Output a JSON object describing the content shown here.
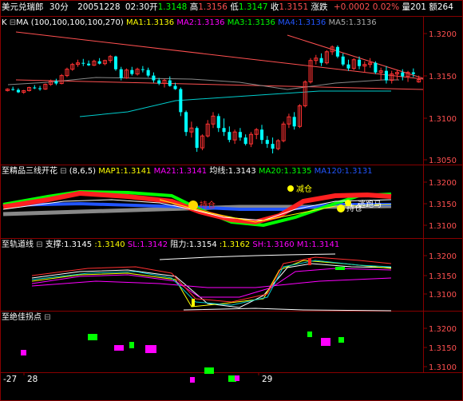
{
  "header": {
    "symbol": "美元兑瑞郎",
    "period": "30分",
    "date": "20051228",
    "time": "02:30",
    "open_label": "开",
    "open": "1.3148",
    "high_label": "高",
    "high": "1.3156",
    "low_label": "低",
    "low": "1.3147",
    "close_label": "收",
    "close": "1.3151",
    "change_label": "涨跌",
    "change": "+0.0002",
    "change_pct": "0.02%",
    "volume_label": "量",
    "volume": "201",
    "amount_label": "额",
    "amount": "264"
  },
  "panes": {
    "main": {
      "toggle_k": "K",
      "toggle_box": "⊟",
      "ma_label": "MA",
      "ma_params": "(100,100,100,100,270)",
      "indicators": [
        {
          "text": "MA1:1.3136",
          "color": "#ffff00"
        },
        {
          "text": "MA2:1.3136",
          "color": "#ff00ff"
        },
        {
          "text": "MA3:1.3136",
          "color": "#00ff00"
        },
        {
          "text": "MA4:1.3136",
          "color": "#2255ff"
        },
        {
          "text": "MA5:1.3136",
          "color": "#aaaaaa"
        }
      ],
      "axis": [
        "1.3200",
        "1.3150",
        "1.3100",
        "1.3050"
      ]
    },
    "sanxian": {
      "title": "至精品三线开花",
      "params": "(8,6,5)",
      "indicators": [
        {
          "text": "MAP1:1.3141",
          "color": "#ffff00"
        },
        {
          "text": "MA21:1.3141",
          "color": "#ff00ff"
        },
        {
          "text": "均线:1.3143",
          "color": "#ffffff"
        },
        {
          "text": "MA20:1.3135",
          "color": "#00ff00"
        },
        {
          "text": "MA120:1.3131",
          "color": "#2255ff"
        }
      ],
      "annotations": {
        "buy": "持仓",
        "reduce": "减仓",
        "jump": "逃跑马",
        "hold": "持仓"
      },
      "axis": [
        "1.3200",
        "1.3150",
        "1.3100"
      ]
    },
    "guidao": {
      "title": "至轨道线",
      "indicators": [
        {
          "text": "支撑:1.3145",
          "color": "#ffffff"
        },
        {
          "text": ":1.3140",
          "color": "#ffff00"
        },
        {
          "text": "SL:1.3142",
          "color": "#ff00ff"
        },
        {
          "text": "阻力:1.3154",
          "color": "#ffffff"
        },
        {
          "text": ":1.3162",
          "color": "#ffff00"
        },
        {
          "text": "SH:1.3160",
          "color": "#ff00ff"
        },
        {
          "text": "M1:1.3141",
          "color": "#ff00ff"
        }
      ],
      "axis": [
        "1.3200",
        "1.3150",
        "1.3100"
      ]
    },
    "guaidian": {
      "title": "至绝佳拐点",
      "axis": [
        "1.3200",
        "1.3150",
        "1.3100"
      ]
    }
  },
  "x_axis": {
    "left": "-27",
    "mid1": "28",
    "mid2": "29"
  },
  "colors": {
    "up": "#ff3232",
    "down": "#00ffff",
    "grid": "#880000",
    "trend": "#ff5050"
  },
  "chart_data": {
    "type": "candlestick",
    "ylim": [
      1.3045,
      1.3225
    ],
    "candles": [
      [
        1.3137,
        1.314,
        1.3136,
        1.3139
      ],
      [
        1.3139,
        1.3142,
        1.3137,
        1.3138
      ],
      [
        1.3138,
        1.314,
        1.3134,
        1.3135
      ],
      [
        1.3135,
        1.3138,
        1.3133,
        1.3137
      ],
      [
        1.3137,
        1.3142,
        1.3136,
        1.3141
      ],
      [
        1.3141,
        1.3144,
        1.3139,
        1.314
      ],
      [
        1.314,
        1.3143,
        1.3137,
        1.3139
      ],
      [
        1.3139,
        1.3146,
        1.3138,
        1.3145
      ],
      [
        1.3145,
        1.3151,
        1.3143,
        1.3149
      ],
      [
        1.3149,
        1.3152,
        1.3144,
        1.3146
      ],
      [
        1.3146,
        1.3158,
        1.3145,
        1.3156
      ],
      [
        1.3156,
        1.3166,
        1.3154,
        1.3164
      ],
      [
        1.3164,
        1.3172,
        1.3162,
        1.317
      ],
      [
        1.317,
        1.3176,
        1.3167,
        1.3172
      ],
      [
        1.3172,
        1.3177,
        1.3168,
        1.3171
      ],
      [
        1.3171,
        1.3175,
        1.3168,
        1.3169
      ],
      [
        1.3169,
        1.3176,
        1.3168,
        1.3174
      ],
      [
        1.3174,
        1.3178,
        1.317,
        1.3171
      ],
      [
        1.3171,
        1.3176,
        1.3169,
        1.3175
      ],
      [
        1.3175,
        1.3182,
        1.3172,
        1.318
      ],
      [
        1.318,
        1.3181,
        1.3162,
        1.3164
      ],
      [
        1.3164,
        1.3167,
        1.315,
        1.3153
      ],
      [
        1.3153,
        1.3165,
        1.3152,
        1.3163
      ],
      [
        1.3163,
        1.3167,
        1.3156,
        1.3158
      ],
      [
        1.3158,
        1.3166,
        1.3156,
        1.3164
      ],
      [
        1.3164,
        1.3168,
        1.316,
        1.3163
      ],
      [
        1.3163,
        1.3166,
        1.3154,
        1.3156
      ],
      [
        1.3156,
        1.316,
        1.3147,
        1.315
      ],
      [
        1.315,
        1.3153,
        1.3144,
        1.3146
      ],
      [
        1.3146,
        1.3152,
        1.3141,
        1.315
      ],
      [
        1.315,
        1.3155,
        1.3142,
        1.3143
      ],
      [
        1.3143,
        1.3147,
        1.3138,
        1.3139
      ],
      [
        1.3139,
        1.3141,
        1.3105,
        1.311
      ],
      [
        1.311,
        1.3112,
        1.308,
        1.3085
      ],
      [
        1.3085,
        1.3098,
        1.3078,
        1.309
      ],
      [
        1.309,
        1.3092,
        1.306,
        1.3065
      ],
      [
        1.3065,
        1.3082,
        1.3062,
        1.308
      ],
      [
        1.308,
        1.31,
        1.3078,
        1.3095
      ],
      [
        1.3095,
        1.311,
        1.309,
        1.3105
      ],
      [
        1.3105,
        1.3108,
        1.3085,
        1.309
      ],
      [
        1.309,
        1.3102,
        1.308,
        1.3085
      ],
      [
        1.3085,
        1.3092,
        1.3072,
        1.3075
      ],
      [
        1.3075,
        1.3088,
        1.307,
        1.3085
      ],
      [
        1.3085,
        1.309,
        1.3074,
        1.3078
      ],
      [
        1.3078,
        1.3082,
        1.3068,
        1.307
      ],
      [
        1.307,
        1.3085,
        1.3066,
        1.3082
      ],
      [
        1.3082,
        1.309,
        1.3076,
        1.3088
      ],
      [
        1.3088,
        1.3094,
        1.307,
        1.3075
      ],
      [
        1.3075,
        1.308,
        1.3065,
        1.307
      ],
      [
        1.307,
        1.3078,
        1.3058,
        1.3064
      ],
      [
        1.3064,
        1.3076,
        1.3062,
        1.3074
      ],
      [
        1.3074,
        1.3098,
        1.3072,
        1.3095
      ],
      [
        1.3095,
        1.3108,
        1.309,
        1.3104
      ],
      [
        1.3104,
        1.311,
        1.3088,
        1.3092
      ],
      [
        1.3092,
        1.312,
        1.309,
        1.3118
      ],
      [
        1.3118,
        1.315,
        1.3116,
        1.3148
      ],
      [
        1.3148,
        1.3178,
        1.3146,
        1.3175
      ],
      [
        1.3175,
        1.3182,
        1.317,
        1.3178
      ],
      [
        1.3178,
        1.3184,
        1.3168,
        1.3172
      ],
      [
        1.3172,
        1.3188,
        1.317,
        1.3186
      ],
      [
        1.3186,
        1.3194,
        1.3182,
        1.3192
      ],
      [
        1.3192,
        1.3194,
        1.3178,
        1.318
      ],
      [
        1.318,
        1.3184,
        1.3168,
        1.317
      ],
      [
        1.317,
        1.3176,
        1.3162,
        1.3165
      ],
      [
        1.3165,
        1.3178,
        1.3163,
        1.3176
      ],
      [
        1.3176,
        1.318,
        1.3164,
        1.3168
      ],
      [
        1.3168,
        1.3174,
        1.316,
        1.317
      ],
      [
        1.317,
        1.3178,
        1.3166,
        1.3172
      ],
      [
        1.3172,
        1.3174,
        1.3158,
        1.316
      ],
      [
        1.316,
        1.3166,
        1.315,
        1.3162
      ],
      [
        1.3162,
        1.3168,
        1.3146,
        1.315
      ],
      [
        1.315,
        1.3162,
        1.3146,
        1.3158
      ],
      [
        1.3158,
        1.3163,
        1.315,
        1.316
      ],
      [
        1.316,
        1.3164,
        1.315,
        1.3155
      ],
      [
        1.3155,
        1.3162,
        1.3148,
        1.316
      ],
      [
        1.316,
        1.3165,
        1.3154,
        1.3158
      ],
      [
        1.3148,
        1.3156,
        1.3147,
        1.3151
      ]
    ]
  }
}
